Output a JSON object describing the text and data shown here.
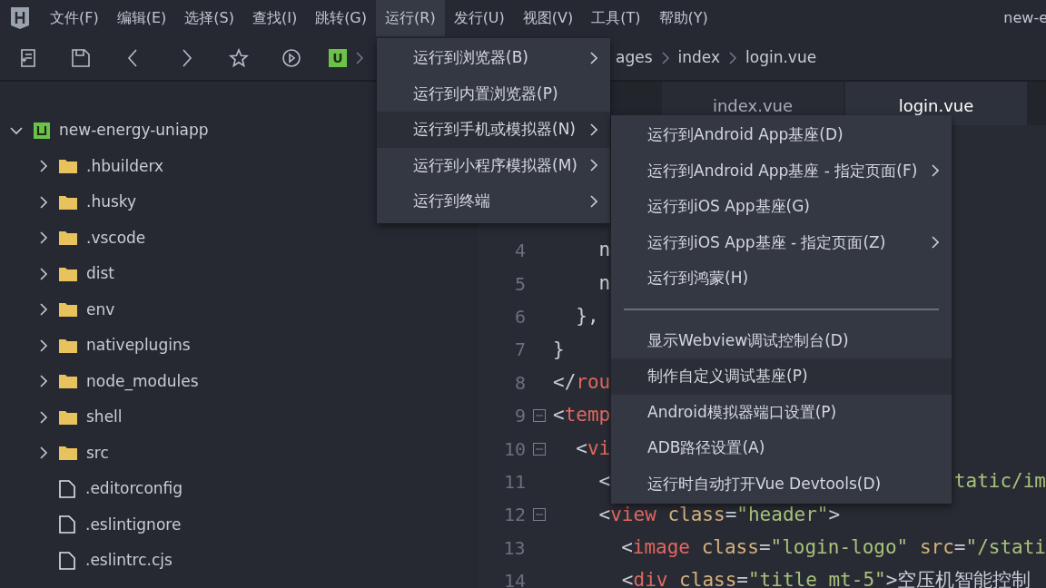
{
  "menubar": {
    "items": [
      {
        "label": "文件(F)",
        "selected": false
      },
      {
        "label": "编辑(E)",
        "selected": false
      },
      {
        "label": "选择(S)",
        "selected": false
      },
      {
        "label": "查找(I)",
        "selected": false
      },
      {
        "label": "跳转(G)",
        "selected": false
      },
      {
        "label": "运行(R)",
        "selected": true
      },
      {
        "label": "发行(U)",
        "selected": false
      },
      {
        "label": "视图(V)",
        "selected": false
      },
      {
        "label": "工具(T)",
        "selected": false
      },
      {
        "label": "帮助(Y)",
        "selected": false
      }
    ],
    "title": "new-e"
  },
  "toolbar": {
    "project_badge": "U",
    "breadcrumb": [
      "ages",
      "index",
      "login.vue"
    ]
  },
  "sidebar": {
    "root": {
      "label": "new-energy-uniapp",
      "expanded": true,
      "children": [
        {
          "label": ".hbuilderx",
          "kind": "folder",
          "expanded": false
        },
        {
          "label": ".husky",
          "kind": "folder",
          "expanded": false
        },
        {
          "label": ".vscode",
          "kind": "folder",
          "expanded": false
        },
        {
          "label": "dist",
          "kind": "folder",
          "expanded": false
        },
        {
          "label": "env",
          "kind": "folder",
          "expanded": false
        },
        {
          "label": "nativeplugins",
          "kind": "folder",
          "expanded": false
        },
        {
          "label": "node_modules",
          "kind": "folder",
          "expanded": false
        },
        {
          "label": "shell",
          "kind": "folder",
          "expanded": false
        },
        {
          "label": "src",
          "kind": "folder",
          "expanded": false
        },
        {
          "label": ".editorconfig",
          "kind": "file"
        },
        {
          "label": ".eslintignore",
          "kind": "file"
        },
        {
          "label": ".eslintrc.cjs",
          "kind": "file"
        }
      ]
    }
  },
  "tabs": [
    {
      "label": "index.vue",
      "selected": false
    },
    {
      "label": "login.vue",
      "selected": true
    }
  ],
  "code": [
    {
      "number": "4",
      "fold": false,
      "segments": [
        {
          "kind": "text",
          "text": "    n"
        }
      ]
    },
    {
      "number": "5",
      "fold": false,
      "segments": [
        {
          "kind": "text",
          "text": "    n"
        }
      ]
    },
    {
      "number": "6",
      "fold": false,
      "segments": [
        {
          "kind": "text",
          "text": "  },"
        }
      ]
    },
    {
      "number": "7",
      "fold": false,
      "segments": [
        {
          "kind": "text",
          "text": "}"
        }
      ]
    },
    {
      "number": "8",
      "fold": false,
      "segments": [
        {
          "kind": "punc",
          "text": "</"
        },
        {
          "kind": "tag",
          "text": "rou"
        }
      ]
    },
    {
      "number": "9",
      "fold": true,
      "segments": [
        {
          "kind": "punc",
          "text": "<"
        },
        {
          "kind": "tag",
          "text": "temp"
        }
      ]
    },
    {
      "number": "10",
      "fold": true,
      "segments": [
        {
          "kind": "punc",
          "text": "  <"
        },
        {
          "kind": "tag",
          "text": "vi"
        }
      ]
    },
    {
      "number": "11",
      "fold": false,
      "segments": [
        {
          "kind": "punc",
          "text": "    <"
        }
      ],
      "tail": [
        {
          "kind": "str",
          "text": "tatic/im"
        }
      ]
    },
    {
      "number": "12",
      "fold": true,
      "segments": [
        {
          "kind": "punc",
          "text": "    <"
        },
        {
          "kind": "tag",
          "text": "view"
        },
        {
          "kind": "attr",
          "text": " class"
        },
        {
          "kind": "punc",
          "text": "="
        },
        {
          "kind": "str",
          "text": "\"header\""
        },
        {
          "kind": "punc",
          "text": ">"
        }
      ]
    },
    {
      "number": "13",
      "fold": false,
      "segments": [
        {
          "kind": "punc",
          "text": "      <"
        },
        {
          "kind": "tag",
          "text": "image"
        },
        {
          "kind": "attr",
          "text": " class"
        },
        {
          "kind": "punc",
          "text": "="
        },
        {
          "kind": "str",
          "text": "\"login-logo\""
        },
        {
          "kind": "attr",
          "text": " src"
        },
        {
          "kind": "punc",
          "text": "="
        },
        {
          "kind": "str",
          "text": "\"/stati"
        }
      ]
    },
    {
      "number": "14",
      "fold": false,
      "segments": [
        {
          "kind": "punc",
          "text": "      <"
        },
        {
          "kind": "tag",
          "text": "div"
        },
        {
          "kind": "attr",
          "text": " class"
        },
        {
          "kind": "punc",
          "text": "="
        },
        {
          "kind": "str",
          "text": "\"title mt-5\""
        },
        {
          "kind": "punc",
          "text": ">"
        },
        {
          "kind": "text",
          "text": "空压机智能控制"
        }
      ]
    }
  ],
  "run_menu": {
    "items": [
      {
        "label": "运行到浏览器(B)",
        "submenu": true,
        "selected": false
      },
      {
        "label": "运行到内置浏览器(P)",
        "submenu": false,
        "selected": false
      },
      {
        "label": "运行到手机或模拟器(N)",
        "submenu": true,
        "selected": true
      },
      {
        "label": "运行到小程序模拟器(M)",
        "submenu": true,
        "selected": false
      },
      {
        "label": "运行到终端",
        "submenu": true,
        "selected": false
      }
    ]
  },
  "device_submenu": {
    "items": [
      {
        "kind": "item",
        "label": "运行到Android App基座(D)",
        "submenu": false,
        "selected": false
      },
      {
        "kind": "item",
        "label": "运行到Android App基座 - 指定页面(F)",
        "submenu": true,
        "selected": false
      },
      {
        "kind": "item",
        "label": "运行到iOS App基座(G)",
        "submenu": false,
        "selected": false
      },
      {
        "kind": "item",
        "label": "运行到iOS App基座 - 指定页面(Z)",
        "submenu": true,
        "selected": false
      },
      {
        "kind": "item",
        "label": "运行到鸿蒙(H)",
        "submenu": false,
        "selected": false
      },
      {
        "kind": "separator"
      },
      {
        "kind": "item",
        "label": "显示Webview调试控制台(D)",
        "submenu": false,
        "selected": false
      },
      {
        "kind": "item",
        "label": "制作自定义调试基座(P)",
        "submenu": false,
        "selected": true
      },
      {
        "kind": "item",
        "label": "Android模拟器端口设置(P)",
        "submenu": false,
        "selected": false
      },
      {
        "kind": "item",
        "label": "ADB路径设置(A)",
        "submenu": false,
        "selected": false
      },
      {
        "kind": "item",
        "label": "运行时自动打开Vue Devtools(D)",
        "submenu": false,
        "selected": false
      }
    ]
  }
}
